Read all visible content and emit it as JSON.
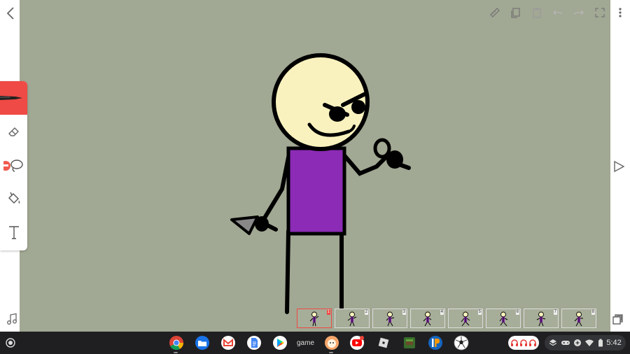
{
  "canvas": {
    "background_color": "#a1a893"
  },
  "topbar": {
    "icons": [
      "ruler-icon",
      "copy-icon",
      "paste-icon",
      "undo-icon",
      "redo-icon",
      "fullscreen-icon",
      "more-vert-icon"
    ]
  },
  "tools": {
    "items": [
      "marker-icon",
      "eraser-icon",
      "lasso-icon",
      "fill-bucket-icon",
      "text-icon"
    ],
    "active_color": "#ef4a45"
  },
  "timeline": {
    "frames": [
      {
        "number": "1",
        "selected": true
      },
      {
        "number": "2",
        "selected": false
      },
      {
        "number": "3",
        "selected": false
      },
      {
        "number": "4",
        "selected": false
      },
      {
        "number": "5",
        "selected": false
      },
      {
        "number": "6",
        "selected": false
      },
      {
        "number": "7",
        "selected": false
      },
      {
        "number": "8",
        "selected": false
      }
    ]
  },
  "drawing": {
    "head_color": "#f9f2be",
    "shirt_color": "#8c2bb5"
  },
  "shelf": {
    "apps": [
      "chrome-icon",
      "files-icon",
      "gmail-icon",
      "docs-icon",
      "play-store-icon",
      "game-app",
      "animation-app-icon",
      "youtube-icon",
      "roblox-icon",
      "minecraft-icon",
      "ibis-paint-icon",
      "soccer-ball-icon"
    ],
    "game_label": "game",
    "time": "5:42"
  }
}
